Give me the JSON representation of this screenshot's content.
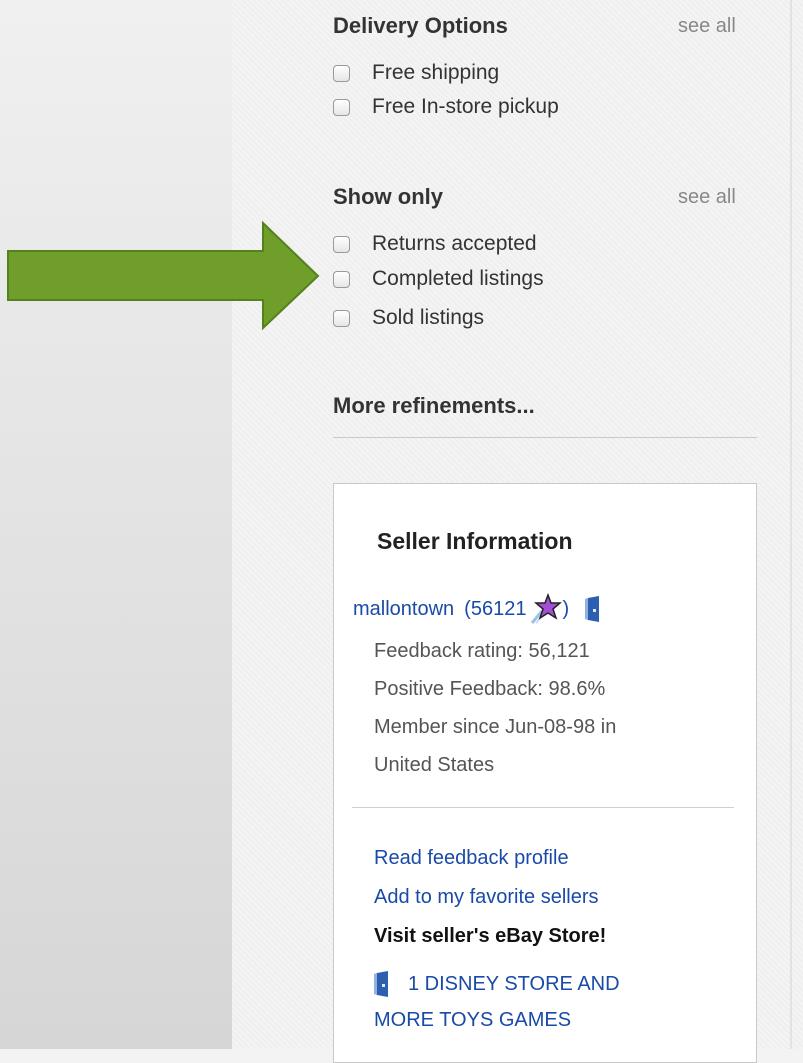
{
  "filters": {
    "delivery": {
      "title": "Delivery Options",
      "see_all": "see all",
      "options": [
        "Free shipping",
        "Free In-store pickup"
      ]
    },
    "show_only": {
      "title": "Show only",
      "see_all": "see all",
      "options": [
        "Returns accepted",
        "Completed listings",
        "Sold listings"
      ]
    },
    "more": "More refinements..."
  },
  "seller": {
    "title": "Seller Information",
    "name": "mallontown",
    "score_open": "(56121",
    "score_close": ")",
    "feedback_rating": "Feedback rating: 56,121",
    "positive_feedback": "Positive Feedback: 98.6%",
    "member_since": "Member since Jun-08-98 in",
    "location": "United States",
    "read_feedback": "Read feedback profile",
    "add_favorite": "Add to my favorite sellers",
    "visit_store": "Visit seller's eBay Store!",
    "store_name_1": "1 DISNEY STORE AND",
    "store_name_2": "MORE TOYS GAMES"
  },
  "colors": {
    "arrow_green": "#6f9f2a",
    "link_blue": "#1a4aa8",
    "star_purple": "#a44ed6"
  },
  "icons": {
    "arrow": "right-arrow-icon",
    "star": "purple-star-icon",
    "store": "store-door-icon"
  }
}
